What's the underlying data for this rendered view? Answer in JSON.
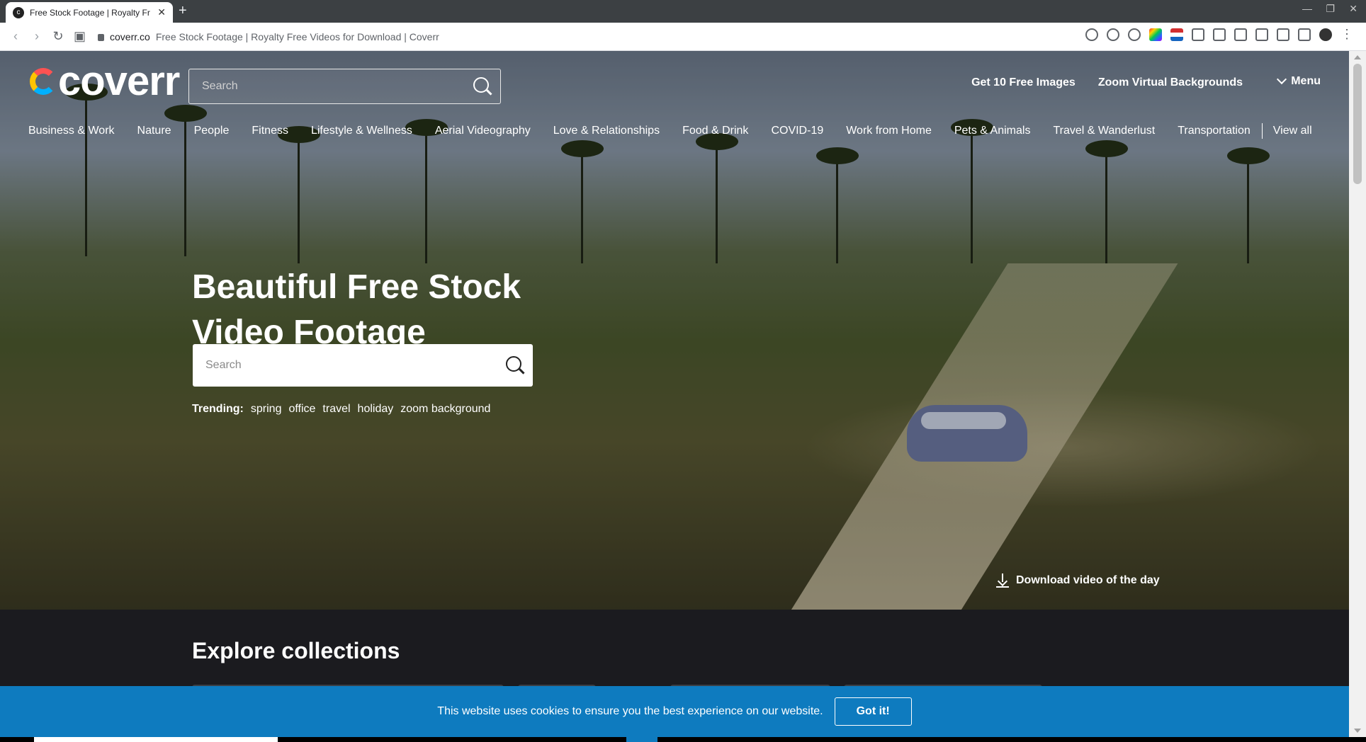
{
  "browser": {
    "tab_title": "Free Stock Footage | Royalty Fr",
    "new_tab": "+",
    "url_domain": "coverr.co",
    "url_title": "Free Stock Footage | Royalty Free Videos for Download | Coverr"
  },
  "header": {
    "logo": "coverr",
    "search_placeholder": "Search",
    "links": [
      "Get 10 Free Images",
      "Zoom Virtual Backgrounds"
    ],
    "menu_label": "Menu"
  },
  "categories": [
    "Business & Work",
    "Nature",
    "People",
    "Fitness",
    "Lifestyle & Wellness",
    "Aerial Videography",
    "Love & Relationships",
    "Food & Drink",
    "COVID-19",
    "Work from Home",
    "Pets & Animals",
    "Travel & Wanderlust",
    "Transportation"
  ],
  "view_all": "View all",
  "hero": {
    "title": "Beautiful Free Stock Video Footage",
    "search_placeholder": "Search",
    "trending_label": "Trending:",
    "trending": [
      "spring",
      "office",
      "travel",
      "holiday",
      "zoom background"
    ],
    "download_label": "Download video of the day"
  },
  "explore": {
    "title": "Explore collections"
  },
  "cookie": {
    "message": "This website uses cookies to ensure you the best experience on our website.",
    "button": "Got it!"
  },
  "colors": {
    "cookie_bar": "#0e7bbf",
    "dark_section": "#1b1b1f",
    "accent_logo": [
      "#ff5252",
      "#ffc400",
      "#00b0ff"
    ]
  }
}
